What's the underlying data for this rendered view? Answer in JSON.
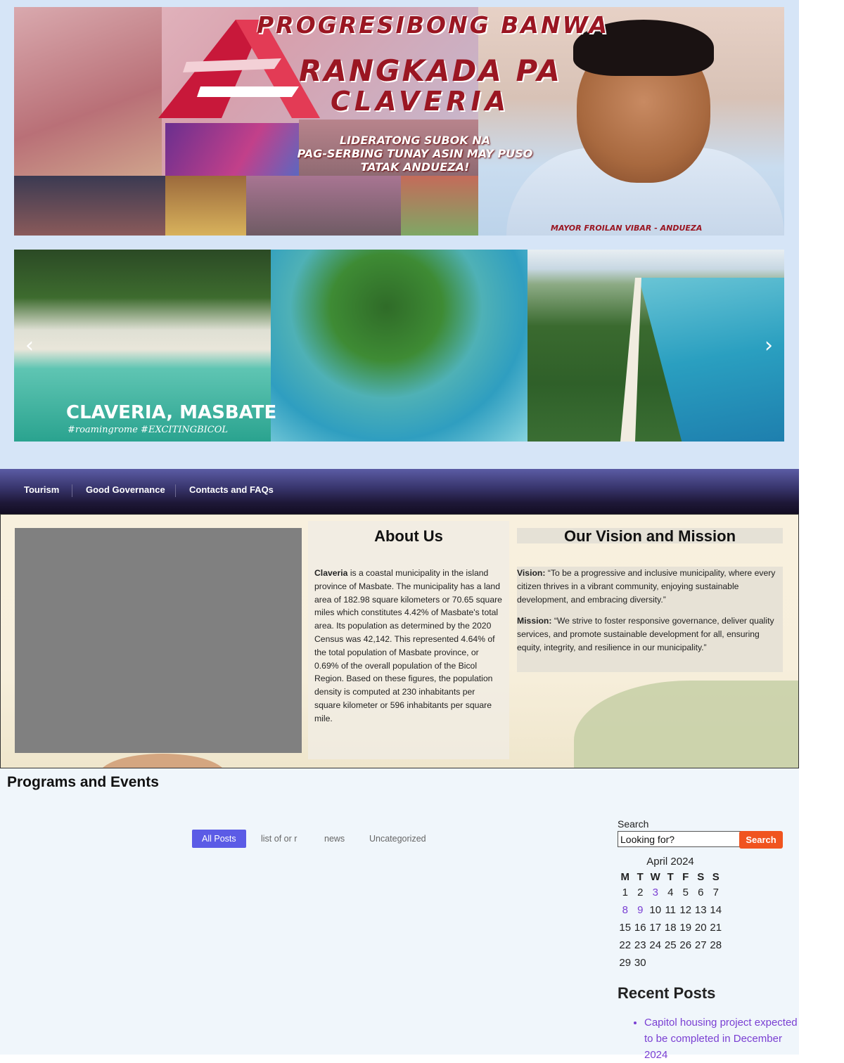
{
  "banner": {
    "title": "PROGRESIBONG BANWA",
    "line1": "RANGKADA PA",
    "line2": "CLAVERIA",
    "slogan": "LIDERATONG SUBOK NA\nPAG-SERBING TUNAY ASIN MAY PUSO\nTATAK ANDUEZA!",
    "mayor": "MAYOR FROILAN VIBAR - ANDUEZA"
  },
  "slider": {
    "caption": "CLAVERIA, MASBATE",
    "tags": "#roamingrome  #EXCITINGBICOL",
    "prev_icon": "‹",
    "next_icon": "›"
  },
  "nav": {
    "items": [
      "Tourism",
      "Good Governance",
      "Contacts and FAQs"
    ]
  },
  "about": {
    "title": "About Us",
    "name": "Claveria",
    "text": " is a coastal municipality in the island province of Masbate. The municipality has a land area of 182.98 square kilometers or 70.65 square miles which constitutes 4.42% of Masbate's total area. Its population as determined by the 2020 Census was 42,142. This represented 4.64% of the total population of Masbate province, or 0.69% of the overall population of the Bicol Region. Based on these figures, the population density is computed at 230 inhabitants per square kilometer or 596 inhabitants per square mile."
  },
  "vision_mission": {
    "title": "Our Vision and Mission",
    "vision_label": "Vision:",
    "vision_text": " “To be a progressive and inclusive municipality, where every citizen thrives in a vibrant community, enjoying sustainable development, and embracing diversity.”",
    "mission_label": "Mission:",
    "mission_text": " “We strive to foster responsive governance, deliver quality services, and promote sustainable development for all, ensuring equity, integrity, and resilience in our municipality.”"
  },
  "programs": {
    "title": "Programs and Events",
    "filters": [
      "All Posts",
      "list of or r",
      "news",
      "Uncategorized"
    ]
  },
  "sidebar": {
    "search_label": "Search",
    "search_value": "Looking for?",
    "search_button": "Search",
    "calendar": {
      "caption": "April 2024",
      "days": [
        "M",
        "T",
        "W",
        "T",
        "F",
        "S",
        "S"
      ],
      "weeks": [
        [
          "1",
          "2",
          "3",
          "4",
          "5",
          "6",
          "7"
        ],
        [
          "8",
          "9",
          "10",
          "11",
          "12",
          "13",
          "14"
        ],
        [
          "15",
          "16",
          "17",
          "18",
          "19",
          "20",
          "21"
        ],
        [
          "22",
          "23",
          "24",
          "25",
          "26",
          "27",
          "28"
        ],
        [
          "29",
          "30",
          "",
          "",
          "",
          "",
          ""
        ]
      ],
      "linked_days": [
        "3",
        "8",
        "9"
      ]
    },
    "recent_title": "Recent Posts",
    "recent_posts": [
      "Capitol housing project expected to be completed in December 2024"
    ]
  },
  "colors": {
    "accent_purple": "#5b5be6",
    "search_orange": "#f0541f",
    "link_purple": "#7a3fd3",
    "brand_red": "#9a1622"
  }
}
